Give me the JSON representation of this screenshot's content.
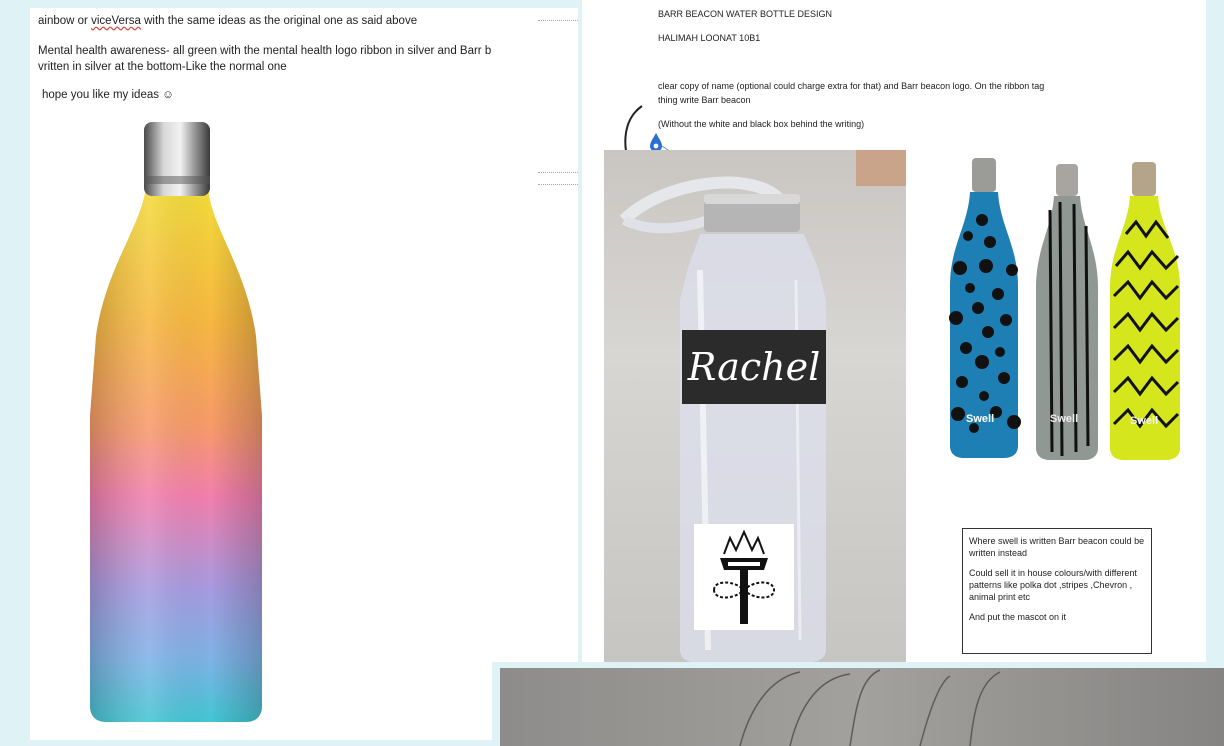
{
  "left_page": {
    "line1_prefix": "ainbow or ",
    "line1_misspelled": "viceVersa",
    "line1_suffix": " with the same ideas as the original one as said above",
    "line2": "Mental health awareness- all green with the mental health logo ribbon in silver and Barr b",
    "line3": "vritten in silver at the bottom-Like the normal one",
    "line4": "hope you like my ideas ☺"
  },
  "right_page": {
    "title": "BARR BEACON WATER BOTTLE DESIGN",
    "author": "HALIMAH LOONAT 10B1",
    "desc1": "clear copy of name (optional could charge extra for that) and Barr beacon logo. On the ribbon tag",
    "desc2": "thing write Barr beacon",
    "desc3": "(Without the white and black box behind the writing)",
    "bottle_name": "Rachel",
    "swell_label": "Swell",
    "note": {
      "p1": "Where swell is written Barr beacon could be written instead",
      "p2": "Could sell it in house colours/with different patterns like polka dot ,stripes ,Chevron , animal print etc",
      "p3": "And put the mascot on it"
    }
  },
  "colors": {
    "background": "#dff3f6",
    "bottle_blue": "#1e7fb4",
    "bottle_grey": "#8f9893",
    "bottle_lime": "#d6e61c"
  }
}
